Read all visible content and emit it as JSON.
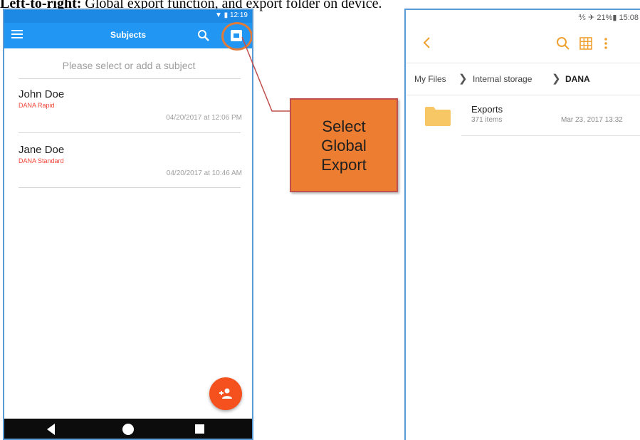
{
  "caption": {
    "bold": "Left-to-right:",
    "text": " Global export function, and export folder on device."
  },
  "left_app": {
    "status_time": "12:19",
    "title": "Subjects",
    "prompt": "Please select or add a subject",
    "subjects": [
      {
        "name": "John Doe",
        "protocol": "DANA Rapid",
        "date": "04/20/2017 at 12:06 PM"
      },
      {
        "name": "Jane Doe",
        "protocol": "DANA Standard",
        "date": "04/20/2017 at 10:46 AM"
      }
    ],
    "colors": {
      "appbar": "#2196f3",
      "fab": "#f4511e",
      "protocol": "#f44336"
    }
  },
  "callout": {
    "text": "Select\nGlobal\nExport",
    "color": "#ed7d31"
  },
  "right_app": {
    "status": "⅘ ✈ 21%▮ 15:08",
    "breadcrumb": [
      "My Files",
      "Internal storage",
      "DANA"
    ],
    "folder": {
      "name": "Exports",
      "count": "371 items",
      "date": "Mar 23, 2017 13:32"
    },
    "colors": {
      "accent": "#f0a030",
      "folder": "#f7c766"
    }
  }
}
